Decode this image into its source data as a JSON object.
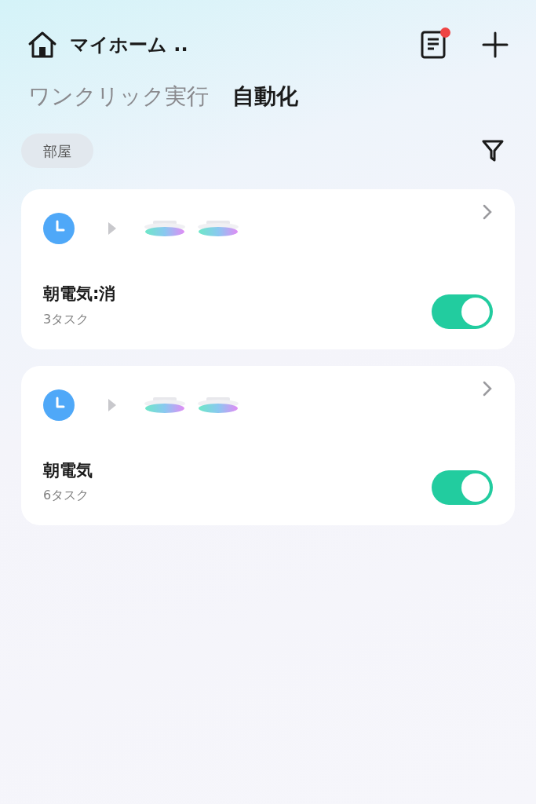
{
  "header": {
    "home_name": "マイホーム ..",
    "notification": true
  },
  "tabs": [
    {
      "label": "ワンクリック実行",
      "selected": false
    },
    {
      "label": "自動化",
      "selected": true
    }
  ],
  "filter_chip": {
    "label": "部屋"
  },
  "automations": [
    {
      "title": "朝電気:消",
      "subtitle": "3タスク",
      "on": true,
      "devices": [
        {
          "kind": "ceiling-light"
        },
        {
          "kind": "ceiling-light"
        }
      ]
    },
    {
      "title": "朝電気",
      "subtitle": "6タスク",
      "on": true,
      "devices": [
        {
          "kind": "ceiling-light"
        },
        {
          "kind": "ceiling-light"
        }
      ]
    }
  ]
}
